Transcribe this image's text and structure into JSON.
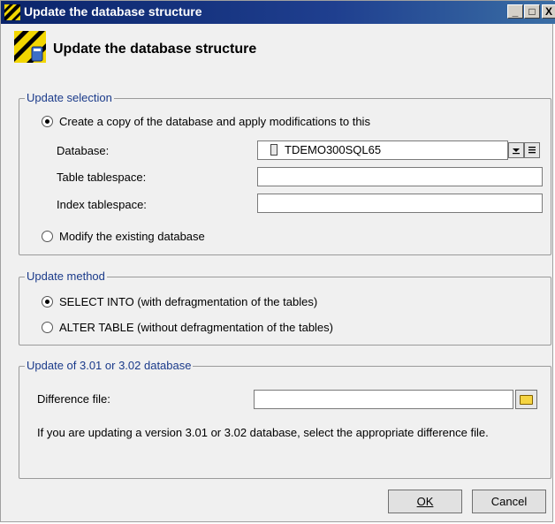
{
  "window": {
    "title": "Update the database structure",
    "header_title": "Update the database structure"
  },
  "update_selection": {
    "legend": "Update selection",
    "create_copy_label": "Create a copy of the database and apply modifications to this",
    "database_label": "Database:",
    "database_value": "TDEMO300SQL65",
    "table_tablespace_label": "Table tablespace:",
    "table_tablespace_value": "",
    "index_tablespace_label": "Index tablespace:",
    "index_tablespace_value": "",
    "modify_existing_label": "Modify the existing database",
    "selected": "create_copy"
  },
  "update_method": {
    "legend": "Update method",
    "select_into_label": "SELECT INTO (with defragmentation of the tables)",
    "alter_table_label": "ALTER TABLE (without defragmentation of the tables)",
    "selected": "select_into"
  },
  "update_301": {
    "legend": "Update of 3.01 or 3.02 database",
    "difference_file_label": "Difference file:",
    "difference_file_value": "",
    "help_text": "If you are updating a version 3.01 or 3.02 database, select the appropriate difference file."
  },
  "buttons": {
    "ok": "OK",
    "cancel": "Cancel"
  },
  "titlebar_buttons": {
    "minimize": "_",
    "maximize": "□",
    "close": "X"
  }
}
